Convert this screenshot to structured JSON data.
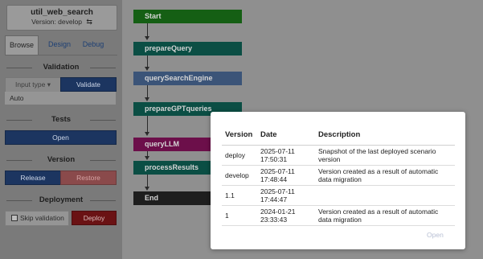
{
  "sidebar": {
    "script_name": "util_web_search",
    "version_label": "Version: develop",
    "tabs": [
      "Browse",
      "Design",
      "Debug"
    ],
    "validation": {
      "title": "Validation",
      "input_type": "Input type",
      "validate_label": "Validate",
      "input_value": "Auto"
    },
    "tests": {
      "title": "Tests",
      "open_label": "Open"
    },
    "version": {
      "title": "Version",
      "release_label": "Release",
      "restore_label": "Restore"
    },
    "deployment": {
      "title": "Deployment",
      "skip_label": "Skip validation",
      "deploy_label": "Deploy"
    }
  },
  "flow": {
    "nodes": [
      {
        "label": "Start",
        "color": "#155f14"
      },
      {
        "label": "prepareQuery",
        "color": "#0b4e44"
      },
      {
        "label": "querySearchEngine",
        "color": "#3b5478"
      },
      {
        "label": "prepareGPTqueries",
        "color": "#0b4e44"
      },
      {
        "label": "queryLLM",
        "color": "#6c0f4a"
      },
      {
        "label": "processResults",
        "color": "#0b4e44"
      },
      {
        "label": "End",
        "color": "#1e1e1e"
      }
    ]
  },
  "modal": {
    "headers": [
      "Version",
      "Date",
      "Description"
    ],
    "rows": [
      {
        "version": "deploy",
        "date": "2025-07-11",
        "time": "17:50:31",
        "description": "Snapshot of the last deployed scenario version"
      },
      {
        "version": "develop",
        "date": "2025-07-11",
        "time": "17:48:44",
        "description": "Version created as a result of automatic data migration"
      },
      {
        "version": "1.1",
        "date": "2025-07-11",
        "time": "17:44:47",
        "description": ""
      },
      {
        "version": "1",
        "date": "2024-01-21",
        "time": "23:33:43",
        "description": "Version created as a result of automatic data migration"
      }
    ],
    "open_label": "Open"
  }
}
